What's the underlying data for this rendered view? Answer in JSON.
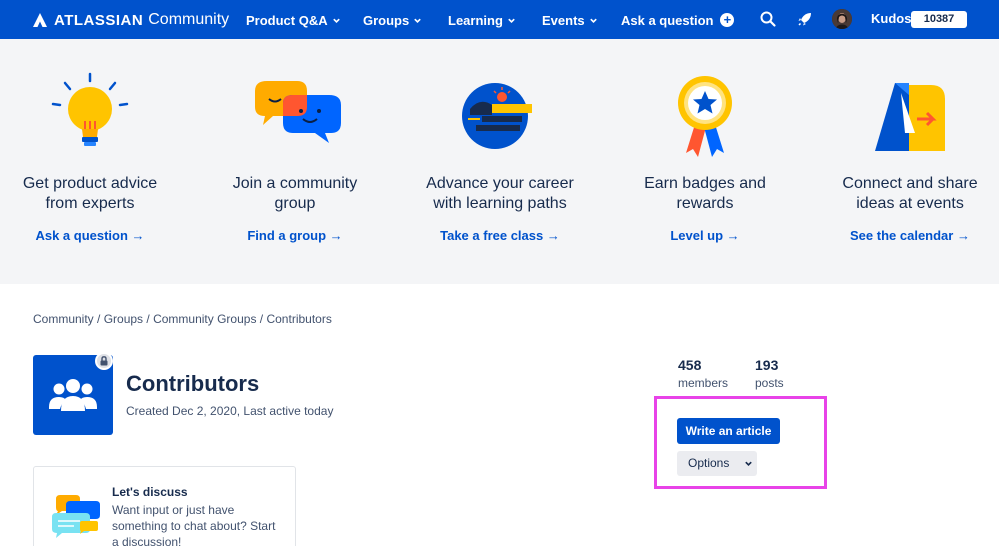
{
  "nav": {
    "brand": "ATLASSIAN",
    "brand_sub": "Community",
    "items": [
      {
        "label": "Product Q&A"
      },
      {
        "label": "Groups"
      },
      {
        "label": "Learning"
      },
      {
        "label": "Events"
      }
    ],
    "ask": "Ask a question",
    "kudos_label": "Kudos",
    "kudos_count": "10387",
    "icons": [
      "search-icon",
      "rocket-icon",
      "avatar"
    ],
    "colors": {
      "nav_bg": "#0052cc",
      "accent": "#0052cc",
      "highlight": "#e843e8"
    }
  },
  "promo": {
    "cards": [
      {
        "title_line1": "Get product advice",
        "title_line2": "from experts",
        "link": "Ask a question →",
        "icon": "lightbulb-icon"
      },
      {
        "title_line1": "Join a community",
        "title_line2": "group",
        "link": "Find a group →",
        "icon": "chat-bubbles-icon"
      },
      {
        "title_line1": "Advance your career",
        "title_line2": "with learning paths",
        "link": "Take a free class →",
        "icon": "learning-path-icon"
      },
      {
        "title_line1": "Earn badges and",
        "title_line2": "rewards",
        "link": "Level up →",
        "icon": "badge-ribbon-icon"
      },
      {
        "title_line1": "Connect and share",
        "title_line2": "ideas at events",
        "link": "See the calendar →",
        "icon": "atlassian-events-icon"
      }
    ]
  },
  "breadcrumb": [
    "Community",
    "Groups",
    "Community Groups",
    "Contributors"
  ],
  "group": {
    "title": "Contributors",
    "meta": "Created Dec 2, 2020, Last active today",
    "icon": "people-group-icon",
    "lock_icon": "lock-icon"
  },
  "stats": {
    "members_count": "458",
    "members_label": "members",
    "posts_count": "193",
    "posts_label": "posts"
  },
  "actions": {
    "write": "Write an article",
    "options": "Options"
  },
  "discuss": {
    "title": "Let's discuss",
    "body": "Want input or just have something to chat about? Start a discussion!",
    "icon": "discussion-bubbles-icon"
  }
}
